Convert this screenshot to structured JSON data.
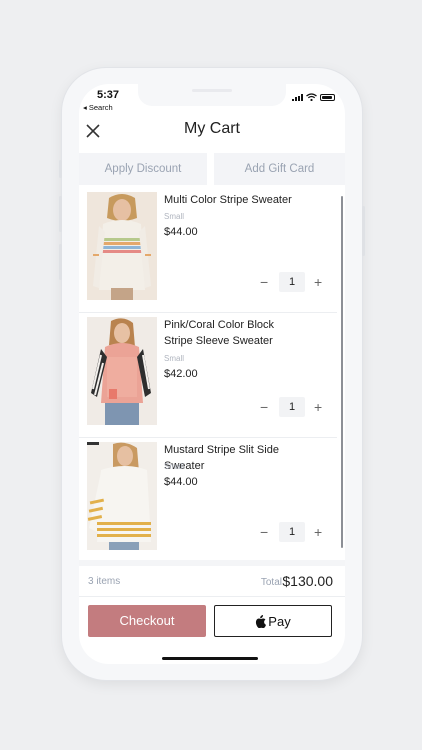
{
  "status_bar": {
    "time": "5:37",
    "back_label": "◂ Search"
  },
  "header": {
    "title": "My Cart",
    "close_icon": "close-icon"
  },
  "actions": {
    "apply_discount": "Apply Discount",
    "add_gift_card": "Add Gift Card"
  },
  "items": [
    {
      "name": "Multi Color Stripe Sweater",
      "size": "Small",
      "price": "$44.00",
      "quantity": "1"
    },
    {
      "name": "Pink/Coral Color Block Stripe Sleeve Sweater",
      "size": "Small",
      "price": "$42.00",
      "quantity": "1"
    },
    {
      "name": "Mustard Stripe Slit Side Sweater",
      "size": "Small",
      "price": "$44.00",
      "quantity": "1"
    }
  ],
  "summary": {
    "item_count": "3 items",
    "total_label": "Total",
    "total_value": "$130.00"
  },
  "buttons": {
    "checkout": "Checkout",
    "apple_pay": "Pay"
  },
  "colors": {
    "accent": "#c37c7f",
    "muted": "#9aa3b2"
  }
}
